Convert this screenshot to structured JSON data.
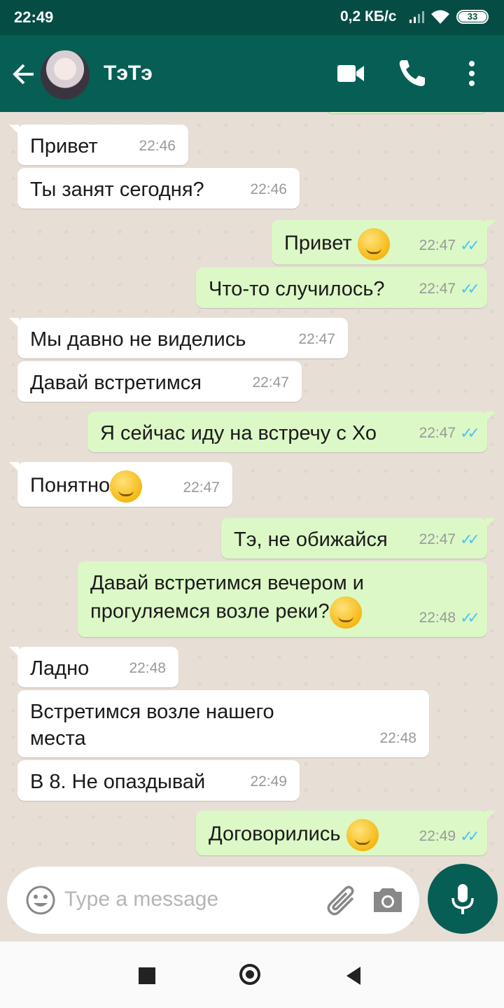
{
  "status_bar": {
    "time": "22:49",
    "network": "0,2 КБ/с",
    "battery": "33"
  },
  "header": {
    "contact_name": "ТэТэ"
  },
  "messages": [
    {
      "text": "Привет",
      "time": "22:46"
    },
    {
      "text": "Ты занят сегодня?",
      "time": "22:46"
    },
    {
      "text": "Привет",
      "time": "22:47",
      "emoji": "hugging-face"
    },
    {
      "text": "Что-то случилось?",
      "time": "22:47"
    },
    {
      "text": "Мы давно не виделись",
      "time": "22:47"
    },
    {
      "text": "Давай встретимся",
      "time": "22:47"
    },
    {
      "text": "Я сейчас иду на встречу с Хо",
      "time": "22:47"
    },
    {
      "text": "Понятно",
      "time": "22:47",
      "emoji": "pensive-face"
    },
    {
      "text": "Тэ, не обижайся",
      "time": "22:47"
    },
    {
      "text": "Давай встретимся вечером и прогуляемся возле реки?",
      "time": "22:48",
      "emoji": "smirking-face"
    },
    {
      "text": "Ладно",
      "time": "22:48"
    },
    {
      "text": "Встретимся возле нашего места",
      "time": "22:48"
    },
    {
      "text": "В 8. Не опаздывай",
      "time": "22:49"
    },
    {
      "text": "Договорились",
      "time": "22:49",
      "emoji": "winking-face"
    }
  ],
  "composer": {
    "placeholder": "Type a message"
  },
  "colors": {
    "header": "#075e54",
    "status": "#054d44",
    "outgoing": "#dcf8c6",
    "incoming": "#ffffff",
    "read_ticks": "#4fc3f7"
  }
}
